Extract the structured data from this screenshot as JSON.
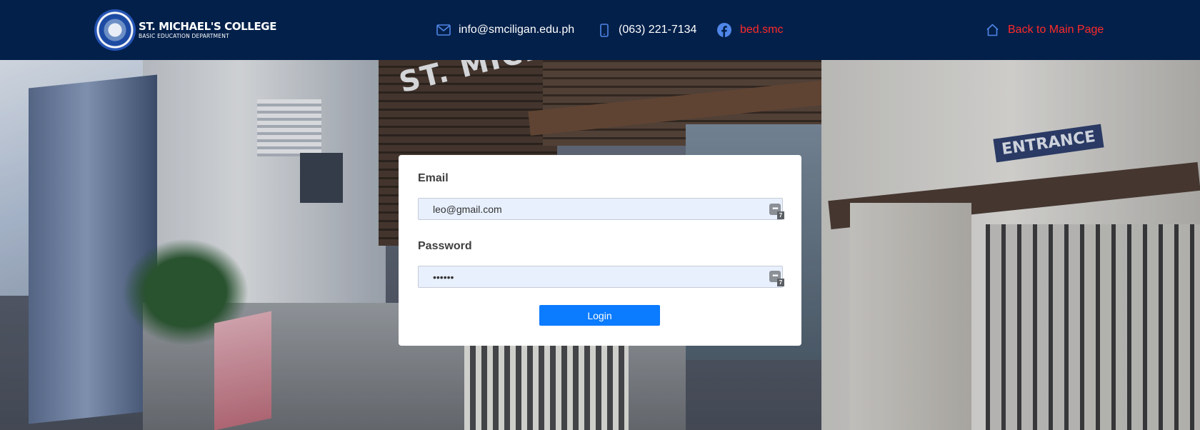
{
  "header": {
    "brand": {
      "name": "ST. MICHAEL'S COLLEGE",
      "subtitle": "BASIC EDUCATION DEPARTMENT",
      "logo_icon": "college-seal-icon"
    },
    "email": {
      "label": "info@smciligan.edu.ph",
      "icon": "envelope-icon"
    },
    "phone": {
      "label": "(063) 221-7134",
      "icon": "mobile-phone-icon"
    },
    "facebook": {
      "label": "bed.smc",
      "icon": "facebook-icon"
    },
    "back": {
      "label": "Back to Main Page",
      "icon": "home-icon"
    },
    "colors": {
      "background": "#03204a",
      "text": "#ffffff",
      "link_accent": "#ff2a2a",
      "icon_blue": "#4f86e8"
    }
  },
  "background": {
    "sign_text": "ST. MICHAELS",
    "entrance_text": "ENTRANCE"
  },
  "login": {
    "email_label": "Email",
    "email_value": "leo@gmail.com",
    "password_label": "Password",
    "password_value": "••••••",
    "password_manager_badge": "7",
    "password_manager_dots": "•••",
    "submit_label": "Login",
    "colors": {
      "input_bg": "#e8f0fe",
      "button": "#0b7bff"
    }
  }
}
